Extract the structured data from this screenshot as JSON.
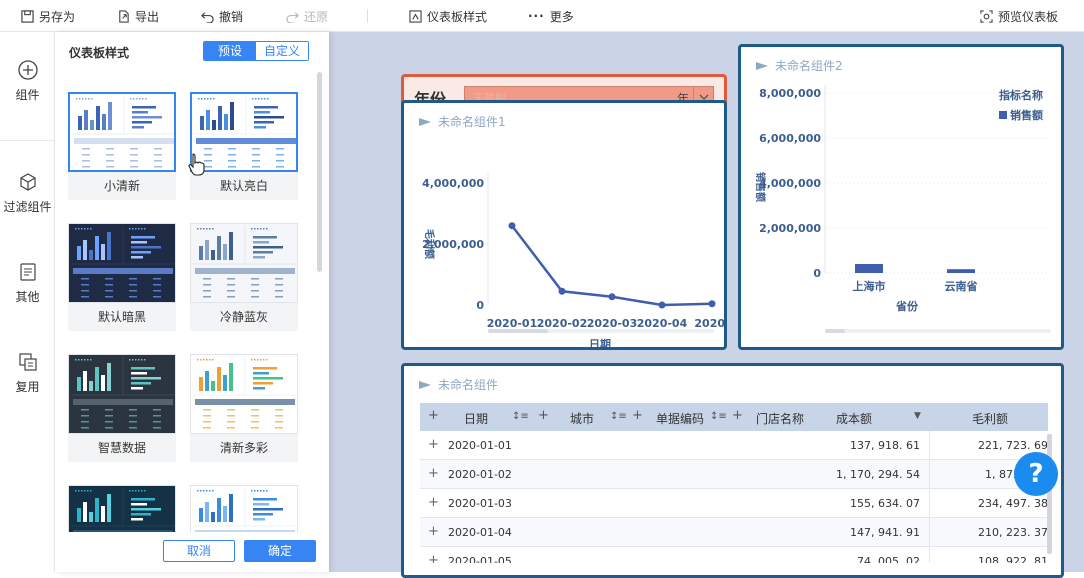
{
  "toolbar": {
    "save_as": "另存为",
    "export": "导出",
    "undo": "撤销",
    "redo": "还原",
    "dashboard_style": "仪表板样式",
    "more": "更多",
    "preview": "预览仪表板"
  },
  "leftnav": {
    "items": [
      {
        "label": "组件",
        "icon": "plus-circle-icon"
      },
      {
        "label": "过滤组件",
        "icon": "cube-icon"
      },
      {
        "label": "其他",
        "icon": "document-icon"
      },
      {
        "label": "复用",
        "icon": "copy-icon"
      }
    ]
  },
  "style_panel": {
    "title": "仪表板样式",
    "tab_preset": "预设",
    "tab_custom": "自定义",
    "themes": [
      "小清新",
      "默认亮白",
      "默认暗黑",
      "冷静蓝灰",
      "智慧数据",
      "清新多彩",
      "",
      ""
    ],
    "cancel": "取消",
    "confirm": "确定"
  },
  "filter_widget": {
    "label": "年份",
    "placeholder": "无限制",
    "unit": "年"
  },
  "widget1": {
    "title": "未命名组件1"
  },
  "widget2": {
    "title": "未命名组件2"
  },
  "widget3": {
    "title": "未命名组件",
    "columns": [
      "日期",
      "城市",
      "单据编码",
      "门店名称",
      "成本额",
      "毛利额"
    ],
    "rows": [
      {
        "date": "2020-01-01",
        "cost": "137, 918. 61",
        "profit": "221, 723. 69"
      },
      {
        "date": "2020-01-02",
        "cost": "1, 170, 294. 54",
        "profit": "1, 873, 755"
      },
      {
        "date": "2020-01-03",
        "cost": "155, 634. 07",
        "profit": "234, 497. 38"
      },
      {
        "date": "2020-01-04",
        "cost": "147, 941. 91",
        "profit": "210, 223. 37"
      },
      {
        "date": "2020-01-05",
        "cost": "74, 005. 02",
        "profit": "108, 922. 81"
      }
    ]
  },
  "help_label": "?",
  "chart_data": [
    {
      "type": "line",
      "x": [
        "2020-01",
        "2020-02",
        "2020-03",
        "2020-04",
        "2020-"
      ],
      "values": [
        2600000,
        450000,
        270000,
        0,
        40000
      ],
      "xlabel": "日期",
      "ylabel": "毛利额",
      "yticks": [
        "4,000,000",
        "2,000,000",
        "0"
      ],
      "ylim": [
        0,
        4000000
      ],
      "color": "#3f5fad"
    },
    {
      "type": "bar",
      "categories": [
        "上海市",
        "云南省"
      ],
      "values": [
        400000,
        170000
      ],
      "xlabel": "省份",
      "ylabel": "销售额",
      "yticks": [
        "8,000,000",
        "6,000,000",
        "4,000,000",
        "2,000,000",
        "0"
      ],
      "ylim": [
        0,
        8000000
      ],
      "legend_title": "指标名称",
      "series": [
        {
          "name": "销售额",
          "values": [
            400000,
            170000
          ]
        }
      ],
      "legend_position": "top-right",
      "color": "#3f5fad"
    }
  ]
}
